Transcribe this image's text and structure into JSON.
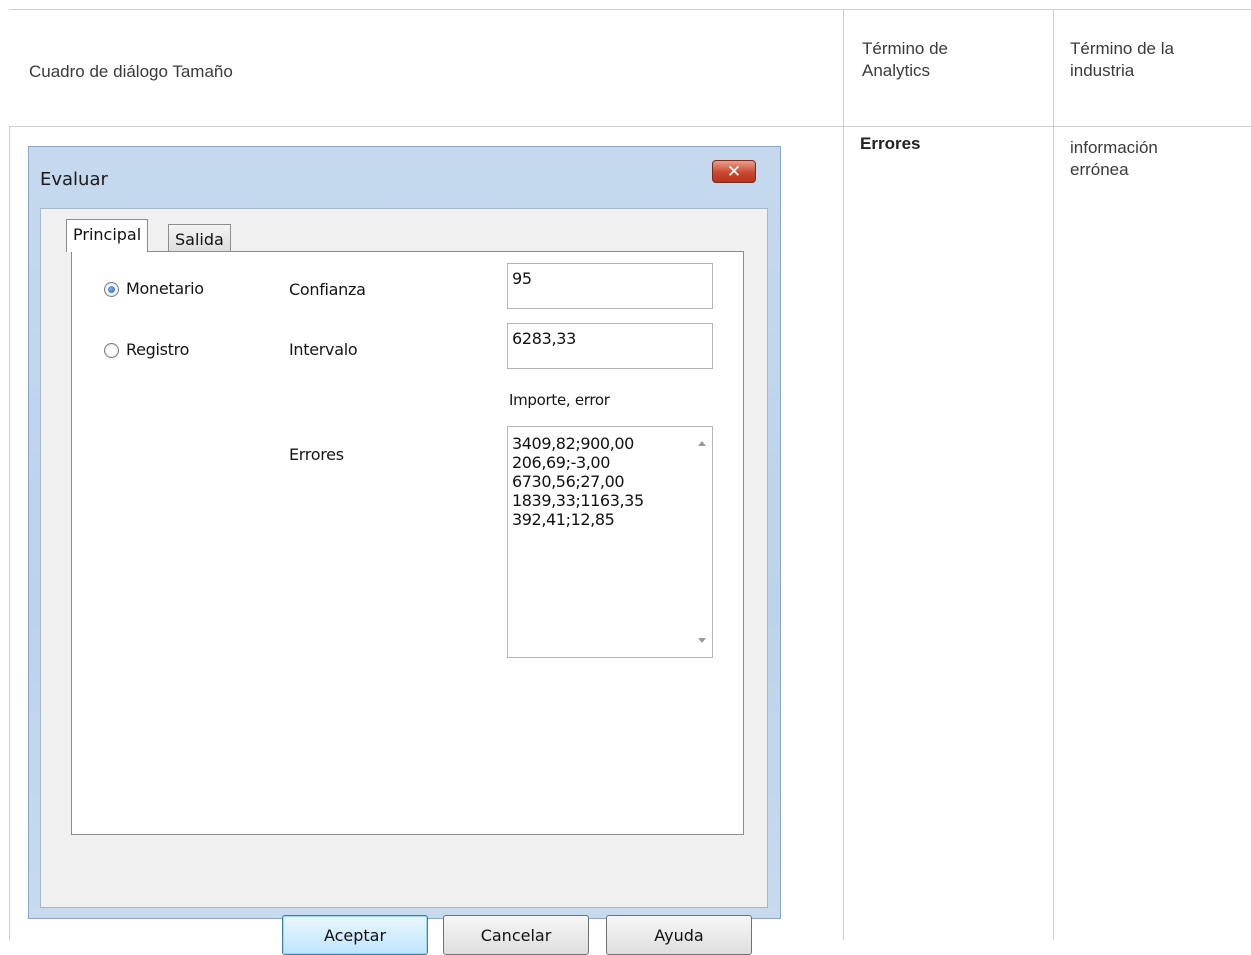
{
  "table": {
    "headers": {
      "col1": "Cuadro de diálogo Tamaño",
      "col2_line1": "Término de",
      "col2_line2": "Analytics",
      "col3_line1": "Término de la",
      "col3_line2": "industria"
    },
    "row": {
      "analytics_term": "Errores",
      "industry_term_line1": "información",
      "industry_term_line2": "errónea"
    }
  },
  "dialog": {
    "title": "Evaluar",
    "close_glyph": "✕",
    "tabs": [
      {
        "label": "Principal",
        "active": true
      },
      {
        "label": "Salida",
        "active": false
      }
    ],
    "radio_options": [
      {
        "label": "Monetario",
        "selected": true
      },
      {
        "label": "Registro",
        "selected": false
      }
    ],
    "confidence_label": "Confianza",
    "confidence_value": "95",
    "interval_label": "Intervalo",
    "interval_value": "6283,33",
    "errors_hint": "Importe, error",
    "errors_label": "Errores",
    "errors_lines": [
      "3409,82;900,00",
      "206,69;-3,00",
      "6730,56;27,00",
      "1839,33;1163,35",
      "392,41;12,85"
    ],
    "buttons": {
      "ok": "Aceptar",
      "cancel": "Cancelar",
      "help": "Ayuda"
    }
  }
}
